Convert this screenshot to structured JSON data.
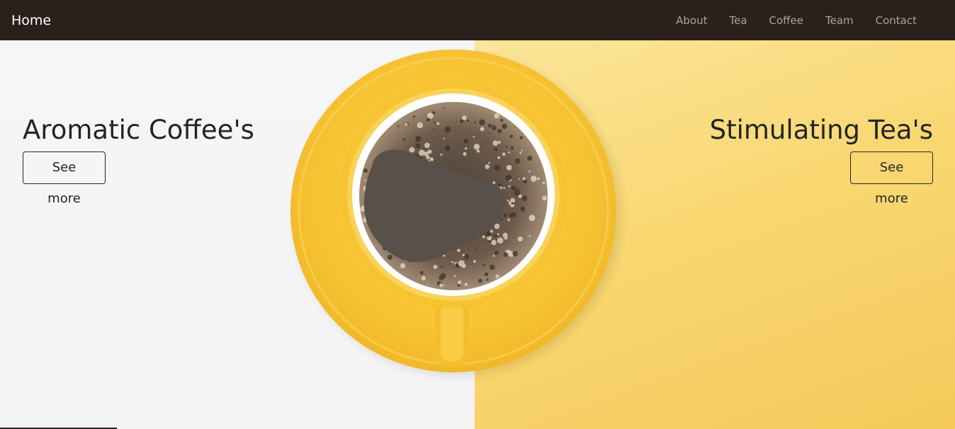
{
  "navbar": {
    "brand": "Home",
    "links": [
      "About",
      "Tea",
      "Coffee",
      "Team",
      "Contact"
    ]
  },
  "hero": {
    "left": {
      "title": "Aromatic Coffee's",
      "button": "See more"
    },
    "right": {
      "title": "Stimulating Tea's",
      "button": "See more"
    },
    "image": "coffee-cup-on-yellow-saucer"
  },
  "colors": {
    "navbar_bg": "#2a211c",
    "nav_link": "#a8a39f",
    "text": "#212529",
    "saucer": "#f7c638",
    "background_yellow": "#f9d873"
  }
}
